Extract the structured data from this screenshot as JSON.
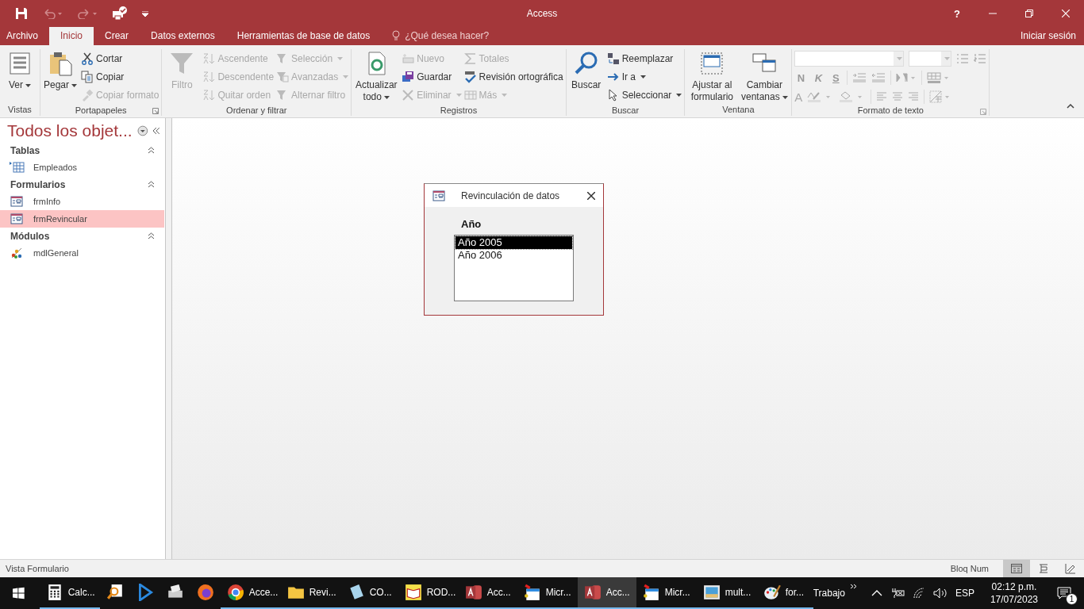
{
  "title_bar": {
    "title": "Access",
    "help": "?"
  },
  "ribbon_tabs": [
    {
      "label": "Archivo",
      "selected": false
    },
    {
      "label": "Inicio",
      "selected": true
    },
    {
      "label": "Crear",
      "selected": false
    },
    {
      "label": "Datos externos",
      "selected": false
    },
    {
      "label": "Herramientas de base de datos",
      "selected": false
    }
  ],
  "tell_me": "¿Qué desea hacer?",
  "sign_in": "Iniciar sesión",
  "ribbon": {
    "groups": [
      {
        "label": "Vistas",
        "launcher": false,
        "commands": [
          {
            "label": "Ver",
            "kind": "large",
            "disabled": false,
            "dropdown": true
          }
        ]
      },
      {
        "label": "Portapapeles",
        "launcher": true,
        "commands": [
          {
            "label": "Pegar",
            "kind": "large",
            "disabled": false,
            "dropdown": true
          },
          {
            "label": "Cortar",
            "kind": "small",
            "disabled": false,
            "dropdown": false
          },
          {
            "label": "Copiar",
            "kind": "small",
            "disabled": false,
            "dropdown": false
          },
          {
            "label": "Copiar formato",
            "kind": "small",
            "disabled": true,
            "dropdown": false
          }
        ]
      },
      {
        "label": "Ordenar y filtrar",
        "launcher": false,
        "commands": [
          {
            "label": "Filtro",
            "kind": "large",
            "disabled": true,
            "dropdown": false
          },
          {
            "label": "Ascendente",
            "kind": "small",
            "disabled": true,
            "dropdown": false
          },
          {
            "label": "Descendente",
            "kind": "small",
            "disabled": true,
            "dropdown": false
          },
          {
            "label": "Quitar orden",
            "kind": "small",
            "disabled": true,
            "dropdown": false
          },
          {
            "label": "Selección",
            "kind": "small",
            "disabled": true,
            "dropdown": true
          },
          {
            "label": "Avanzadas",
            "kind": "small",
            "disabled": true,
            "dropdown": true
          },
          {
            "label": "Alternar filtro",
            "kind": "small",
            "disabled": true,
            "dropdown": false
          }
        ]
      },
      {
        "label": "Registros",
        "launcher": false,
        "commands": [
          {
            "label": "Actualizar todo",
            "kind": "large",
            "disabled": false,
            "dropdown": true
          },
          {
            "label": "Nuevo",
            "kind": "small",
            "disabled": true,
            "dropdown": false
          },
          {
            "label": "Guardar",
            "kind": "small",
            "disabled": false,
            "dropdown": false
          },
          {
            "label": "Eliminar",
            "kind": "small",
            "disabled": true,
            "dropdown": true
          },
          {
            "label": "Totales",
            "kind": "small",
            "disabled": true,
            "dropdown": false
          },
          {
            "label": "Revisión ortográfica",
            "kind": "small",
            "disabled": false,
            "dropdown": false
          },
          {
            "label": "Más",
            "kind": "small",
            "disabled": true,
            "dropdown": true
          }
        ]
      },
      {
        "label": "Buscar",
        "launcher": false,
        "commands": [
          {
            "label": "Buscar",
            "kind": "large",
            "disabled": false,
            "dropdown": false
          },
          {
            "label": "Reemplazar",
            "kind": "small",
            "disabled": false,
            "dropdown": false
          },
          {
            "label": "Ir a",
            "kind": "small",
            "disabled": false,
            "dropdown": true
          },
          {
            "label": "Seleccionar",
            "kind": "small",
            "disabled": false,
            "dropdown": true
          }
        ]
      },
      {
        "label": "Ventana",
        "launcher": false,
        "commands": [
          {
            "label": "Ajustar al formulario",
            "kind": "large",
            "disabled": false,
            "dropdown": false
          },
          {
            "label": "Cambiar ventanas",
            "kind": "large",
            "disabled": false,
            "dropdown": true
          }
        ]
      }
    ],
    "text_format": {
      "label": "Formato de texto",
      "launcher": true,
      "font_styles": [
        "N",
        "K",
        "S"
      ],
      "font_color": "A"
    }
  },
  "navigation_pane": {
    "title": "Todos los objet...",
    "sections": [
      {
        "label": "Tablas",
        "expanded": true,
        "items": [
          {
            "label": "Empleados",
            "selected": false
          }
        ]
      },
      {
        "label": "Formularios",
        "expanded": true,
        "items": [
          {
            "label": "frmInfo",
            "selected": false
          },
          {
            "label": "frmRevincular",
            "selected": true
          }
        ]
      },
      {
        "label": "Módulos",
        "expanded": true,
        "items": [
          {
            "label": "mdlGeneral",
            "selected": false
          }
        ]
      }
    ]
  },
  "dialog": {
    "title": "Revinculación de datos",
    "field_label": "Año",
    "options": [
      {
        "label": "Año 2005",
        "selected": true
      },
      {
        "label": "Año 2006",
        "selected": false
      }
    ]
  },
  "status_bar": {
    "text": "Vista Formulario",
    "indicator": "Bloq Num",
    "views": [
      {
        "selected": true
      },
      {
        "selected": false
      },
      {
        "selected": false
      }
    ]
  },
  "taskbar": {
    "items": [
      {
        "label": "Calc...",
        "running": true,
        "selected": false
      },
      {
        "running": false,
        "selected": false
      },
      {
        "running": false,
        "selected": false
      },
      {
        "running": false,
        "selected": false
      },
      {
        "running": false,
        "selected": false
      },
      {
        "label": "Acce...",
        "running": true,
        "selected": false
      },
      {
        "label": "Revi...",
        "running": true,
        "selected": false
      },
      {
        "label": "CO...",
        "running": true,
        "selected": false
      },
      {
        "label": "ROD...",
        "running": true,
        "selected": false
      },
      {
        "label": "Acc...",
        "running": true,
        "selected": false
      },
      {
        "label": "Micr...",
        "running": true,
        "selected": false
      },
      {
        "label": "Acc...",
        "running": true,
        "selected": true
      },
      {
        "label": "Micr...",
        "running": true,
        "selected": false
      },
      {
        "label": "mult...",
        "running": true,
        "selected": false
      },
      {
        "label": "for...",
        "running": true,
        "selected": false
      }
    ],
    "toolbar_label": "Trabajo",
    "language": "ESP",
    "time": "02:12 p.m.",
    "date": "17/07/2023",
    "notifications": "1"
  }
}
